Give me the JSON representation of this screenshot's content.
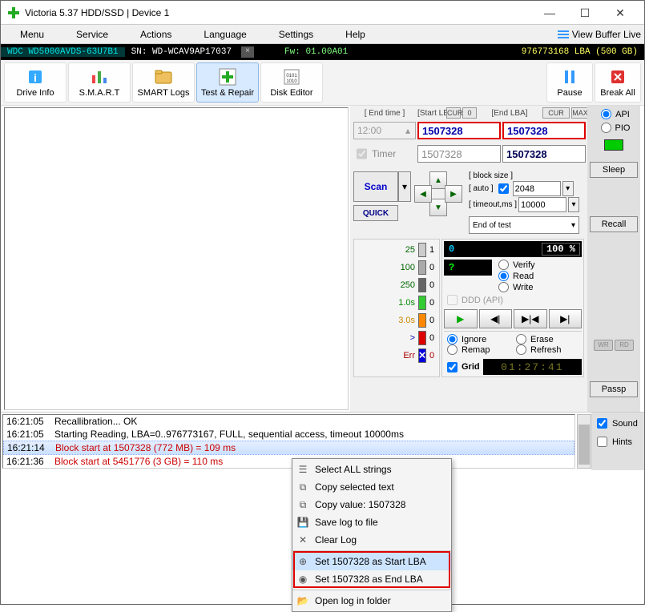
{
  "window": {
    "title": "Victoria 5.37 HDD/SSD | Device 1"
  },
  "menu": {
    "items": [
      "Menu",
      "Service",
      "Actions",
      "Language",
      "Settings",
      "Help"
    ],
    "right": "View Buffer Live"
  },
  "info": {
    "model": "WDC WD5000AVDS-63U7B1",
    "sn_label": "SN: WD-WCAV9AP17037",
    "fw": "Fw: 01.00A01",
    "lba": "976773168 LBA (500 GB)"
  },
  "tools": {
    "driveinfo": "Drive Info",
    "smart": "S.M.A.R.T",
    "smartlogs": "SMART Logs",
    "testrepair": "Test & Repair",
    "diskeditor": "Disk Editor",
    "pause": "Pause",
    "breakall": "Break All"
  },
  "lba": {
    "endtime_label": "[ End time ]",
    "start_label": "[Start LBA]",
    "end_label": "[End LBA]",
    "cur": "CUR",
    "zero": "0",
    "max": "MAX",
    "time_value": "12:00",
    "start_value": "1507328",
    "end_value": "1507328",
    "timer_label": "Timer",
    "start2": "1507328",
    "end2": "1507328"
  },
  "scan": {
    "scan": "Scan",
    "quick": "QUICK",
    "blocksize_label": "[ block size ]",
    "auto_label": "[ auto ]",
    "blocksize_value": "2048",
    "timeout_label": "[ timeout,ms ]",
    "timeout_value": "10000",
    "endoftest": "End of test"
  },
  "stats": {
    "t25": "25",
    "v25": "1",
    "t100": "100",
    "v100": "0",
    "t250": "250",
    "v250": "0",
    "t1s": "1.0s",
    "v1s": "0",
    "t3s": "3.0s",
    "v3s": "0",
    "tgt": ">",
    "vgt": "0",
    "terr": "Err",
    "verr": "0"
  },
  "progress": {
    "current": "0",
    "pct": "100  %",
    "q": "?",
    "verify": "Verify",
    "read": "Read",
    "write": "Write",
    "ddd": "DDD (API)",
    "ignore": "Ignore",
    "erase": "Erase",
    "remap": "Remap",
    "refresh": "Refresh",
    "grid": "Grid",
    "timer": "01:27:41"
  },
  "right": {
    "api": "API",
    "pio": "PIO",
    "sleep": "Sleep",
    "recall": "Recall",
    "passp": "Passp",
    "wr": "WR",
    "rd": "RD"
  },
  "log": {
    "rows": [
      {
        "t": "16:21:05",
        "m": "Recallibration... OK",
        "cls": ""
      },
      {
        "t": "16:21:05",
        "m": "Starting Reading, LBA=0..976773167, FULL, sequential access, timeout 10000ms",
        "cls": ""
      },
      {
        "t": "16:21:14",
        "m": "Block start at 1507328 (772 MB)  = 109 ms",
        "cls": "red",
        "sel": true
      },
      {
        "t": "16:21:36",
        "m": "Block start at 5451776 (3 GB)  = 110 ms",
        "cls": "red"
      }
    ]
  },
  "opts": {
    "sound": "Sound",
    "hints": "Hints"
  },
  "ctx": {
    "select_all": "Select ALL strings",
    "copy_sel": "Copy selected text",
    "copy_val": "Copy value: 1507328",
    "save_log": "Save log to file",
    "clear_log": "Clear Log",
    "set_start": "Set 1507328 as Start LBA",
    "set_end": "Set 1507328 as End LBA",
    "open_log": "Open log in folder"
  }
}
